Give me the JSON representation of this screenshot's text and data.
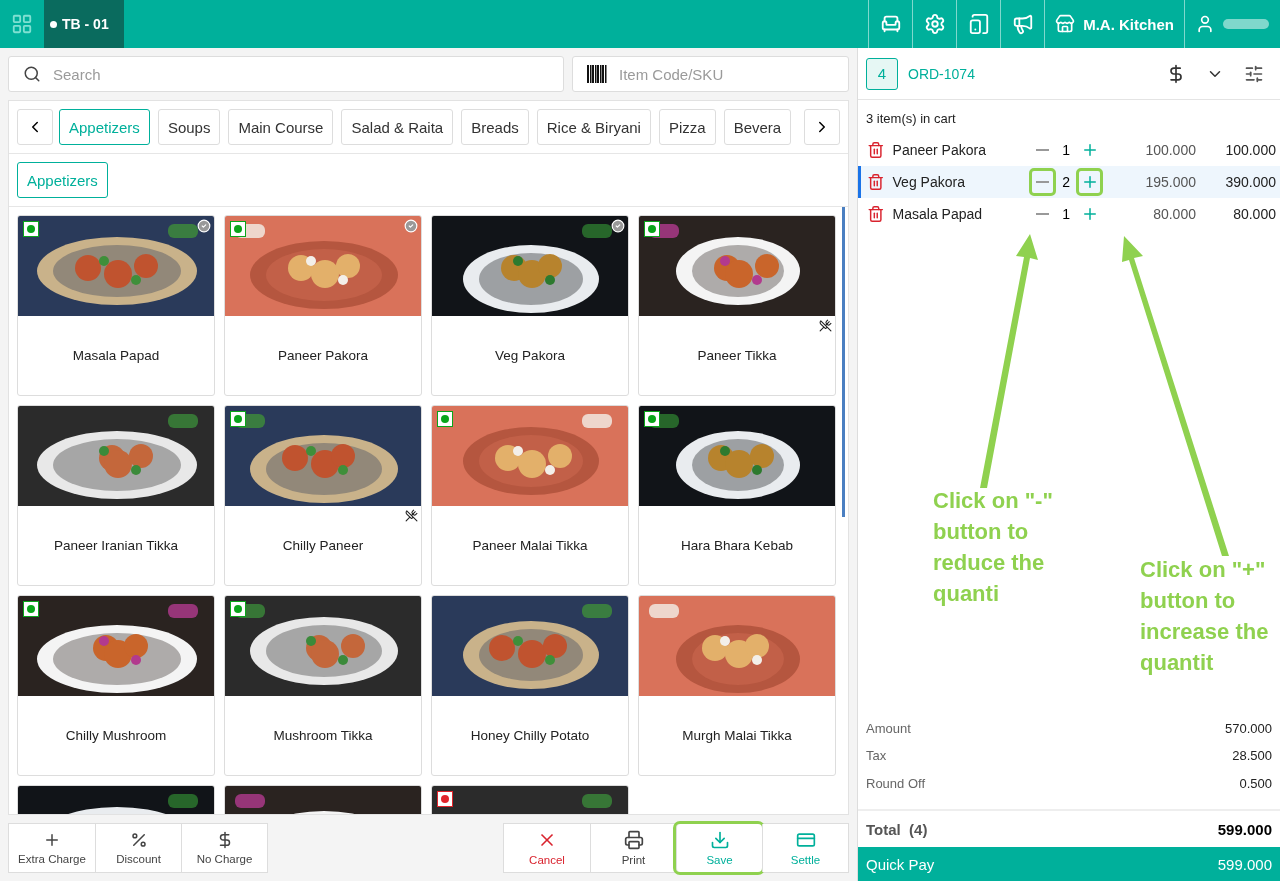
{
  "header": {
    "table_tab": "TB - 01",
    "outlet": "M.A. Kitchen"
  },
  "search": {
    "placeholder": "Search"
  },
  "sku": {
    "placeholder": "Item Code/SKU"
  },
  "categories": [
    {
      "label": "Appetizers",
      "selected": true
    },
    {
      "label": "Soups",
      "selected": false
    },
    {
      "label": "Main Course",
      "selected": false
    },
    {
      "label": "Salad & Raita",
      "selected": false
    },
    {
      "label": "Breads",
      "selected": false
    },
    {
      "label": "Rice & Biryani",
      "selected": false
    },
    {
      "label": "Pizza",
      "selected": false
    },
    {
      "label": "Bevera",
      "selected": false
    }
  ],
  "subcategories": [
    {
      "label": "Appetizers",
      "selected": true
    }
  ],
  "items": [
    {
      "name": "Masala Papad",
      "color": "#0aa51a",
      "in_cart": true,
      "no_cutlery": false
    },
    {
      "name": "Paneer Pakora",
      "color": "#0aa51a",
      "in_cart": true,
      "no_cutlery": false
    },
    {
      "name": "Veg Pakora",
      "in_cart": true,
      "no_cutlery": false
    },
    {
      "name": "Paneer Tikka",
      "color": "#0aa51a",
      "in_cart": false,
      "no_cutlery": true
    },
    {
      "name": "Paneer Iranian Tikka",
      "in_cart": false,
      "no_cutlery": false
    },
    {
      "name": "Chilly Paneer",
      "color": "#0aa51a",
      "in_cart": false,
      "no_cutlery": true
    },
    {
      "name": "Paneer Malai Tikka",
      "color": "#0aa51a",
      "in_cart": false,
      "no_cutlery": false
    },
    {
      "name": "Hara Bhara Kebab",
      "color": "#0aa51a",
      "in_cart": false,
      "no_cutlery": false
    },
    {
      "name": "Chilly Mushroom",
      "color": "#0aa51a",
      "in_cart": false,
      "no_cutlery": false
    },
    {
      "name": "Mushroom Tikka",
      "color": "#0aa51a",
      "in_cart": false,
      "no_cutlery": false
    },
    {
      "name": "Honey Chilly Potato",
      "in_cart": false,
      "no_cutlery": false
    },
    {
      "name": "Murgh Malai Tikka",
      "in_cart": false,
      "no_cutlery": false
    },
    {
      "kind": "picture"
    },
    {
      "kind": "picture"
    },
    {
      "kind": "picture",
      "color": "#e0242b"
    }
  ],
  "actions_left": [
    {
      "kind": "plus",
      "label": "Extra Charge"
    },
    {
      "kind": "percent",
      "label": "Discount"
    },
    {
      "kind": "nocharge",
      "label": "No Charge"
    }
  ],
  "actions_right": [
    {
      "kind": "cancel",
      "label": "Cancel",
      "highlighted": false
    },
    {
      "kind": "print",
      "label": "Print",
      "highlighted": false
    },
    {
      "kind": "save",
      "label": "Save",
      "highlighted": true
    },
    {
      "kind": "settle",
      "label": "Settle",
      "highlighted": false
    }
  ],
  "order": {
    "guests": "4",
    "number": "ORD-1074"
  },
  "cart_count": "3 item(s) in cart",
  "cart": [
    {
      "name": "Paneer Pakora",
      "qty": "1",
      "price": "100.000",
      "total": "100.000",
      "selected": false,
      "highlighted": false
    },
    {
      "name": "Veg Pakora",
      "qty": "2",
      "price": "195.000",
      "total": "390.000",
      "selected": true,
      "highlighted": true
    },
    {
      "name": "Masala Papad",
      "qty": "1",
      "price": "80.000",
      "total": "80.000",
      "selected": false,
      "highlighted": false
    }
  ],
  "summary": [
    {
      "label": "Amount",
      "value": "570.000"
    },
    {
      "label": "Tax",
      "value": "28.500"
    },
    {
      "label": "Round Off",
      "value": "0.500"
    }
  ],
  "total": {
    "label": "Total",
    "count": "(4)",
    "value": "599.000"
  },
  "quick_pay": {
    "label": "Quick Pay",
    "value": "599.000"
  },
  "annotations": [
    {
      "text": "Click on \"-\" button to reduce the quanti"
    },
    {
      "text": "Click on \"+\" button to increase the quantit"
    }
  ]
}
